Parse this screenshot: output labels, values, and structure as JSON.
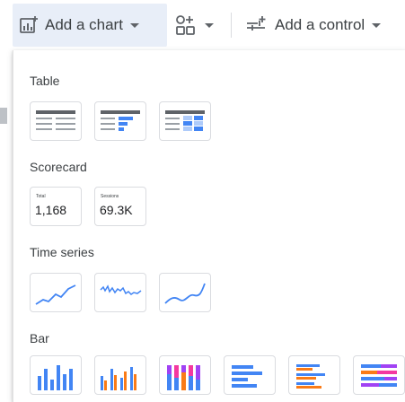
{
  "toolbar": {
    "add_chart_label": "Add a chart",
    "add_control_label": "Add a control",
    "icons": {
      "add_chart": "chart-plus-icon",
      "community": "shapes-plus-icon",
      "add_control": "sliders-plus-icon",
      "caret": "chevron-down-icon"
    }
  },
  "sections": {
    "table": {
      "title": "Table"
    },
    "scorecard": {
      "title": "Scorecard",
      "items": [
        {
          "caption": "Total",
          "value": "1,168"
        },
        {
          "caption": "Sessions",
          "value": "69.3K"
        }
      ]
    },
    "time_series": {
      "title": "Time series"
    },
    "bar": {
      "title": "Bar"
    }
  },
  "colors": {
    "accent": "#4285f4",
    "accent_light": "#aecbfa",
    "orange": "#fa7b17",
    "purple": "#a142f4",
    "pink": "#f439a0",
    "toolbar_active": "#e8eef8",
    "tile_border": "#dadce0"
  }
}
